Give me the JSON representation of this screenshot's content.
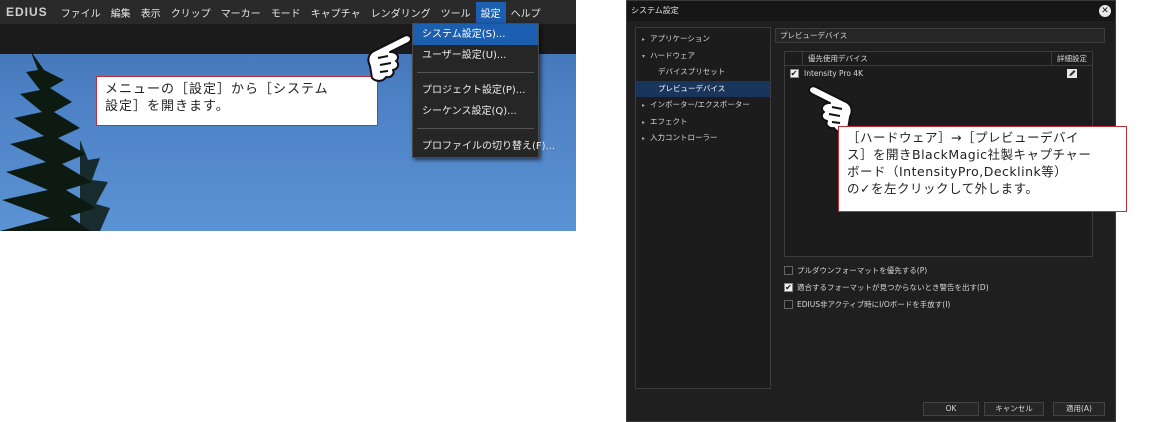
{
  "left": {
    "logo": "EDIUS",
    "menu": [
      "ファイル",
      "編集",
      "表示",
      "クリップ",
      "マーカー",
      "モード",
      "キャプチャ",
      "レンダリング",
      "ツール",
      "設定",
      "ヘルプ"
    ],
    "active_menu_index": 9,
    "dropdown": [
      "システム設定(S)...",
      "ユーザー設定(U)...",
      "プロジェクト設定(P)...",
      "シーケンス設定(Q)...",
      "プロファイルの切り替え(F)..."
    ],
    "callout_line1": "メニューの［設定］から［システム",
    "callout_line2": "設定］を開きます。"
  },
  "dialog": {
    "title": "システム設定",
    "close_icon": "close-icon",
    "tree": {
      "application": "アプリケーション",
      "hardware": "ハードウェア",
      "device_preset": "デバイスプリセット",
      "preview_device": "プレビューデバイス",
      "importer_exporter": "インポーター/エクスポーター",
      "effect": "エフェクト",
      "input_controller": "入力コントローラー"
    },
    "content_title": "プレビューデバイス",
    "table": {
      "col_device": "優先使用デバイス",
      "col_detail": "詳細設定",
      "row_device": "Intensity Pro 4K",
      "row_checked": true
    },
    "options": {
      "pulldown": "プルダウンフォーマットを優先する(P)",
      "pulldown_checked": false,
      "warn": "適合するフォーマットが見つからないとき警告を出す(D)",
      "warn_checked": true,
      "release": "EDIUS非アクティブ時にI/Oボードを手放す(I)",
      "release_checked": false
    },
    "buttons": {
      "ok": "OK",
      "cancel": "キャンセル",
      "apply": "適用(A)"
    },
    "callout_line1": "［ハードウェア］→［プレビューデバイ",
    "callout_line2": "ス］を開きBlackMagic社製キャプチャー",
    "callout_line3": "ボード（IntensityPro,Decklink等）",
    "callout_line4": "の✓を左クリックして外します。"
  }
}
